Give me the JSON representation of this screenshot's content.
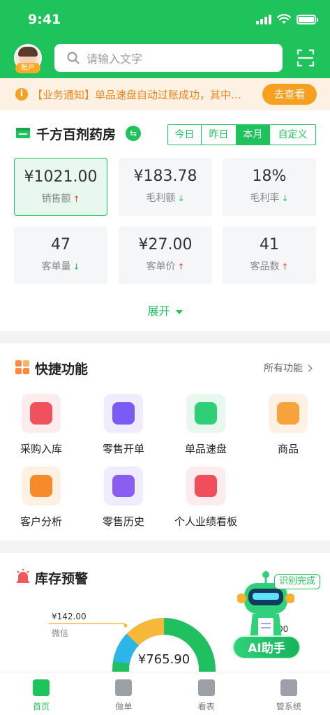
{
  "status_bar": {
    "time": "9:41"
  },
  "header": {
    "account_label": "账户",
    "search_placeholder": "请输入文字"
  },
  "notice": {
    "text": "【业务通知】单品速盘自动过账成功，其中…",
    "button": "去查看"
  },
  "store": {
    "name": "千方百剂药房",
    "periods": [
      "今日",
      "昨日",
      "本月",
      "自定义"
    ],
    "active_period": "本月",
    "metrics": [
      {
        "value": "¥1021.00",
        "label": "销售额",
        "trend": "up",
        "active": true
      },
      {
        "value": "¥183.78",
        "label": "毛利额",
        "trend": "down"
      },
      {
        "value": "18%",
        "label": "毛利率",
        "trend": "down"
      },
      {
        "value": "47",
        "label": "客单量",
        "trend": "down"
      },
      {
        "value": "¥27.00",
        "label": "客单价",
        "trend": "up"
      },
      {
        "value": "41",
        "label": "客品数",
        "trend": "up"
      }
    ],
    "expand_label": "展开"
  },
  "quick": {
    "title": "快捷功能",
    "more_label": "所有功能",
    "items": [
      {
        "label": "采购入库",
        "icon": "shopping-basket-icon",
        "color": "#f0515e",
        "bg": "#fdecee"
      },
      {
        "label": "零售开单",
        "icon": "checklist-icon",
        "color": "#7a5cf5",
        "bg": "#efedfd"
      },
      {
        "label": "单品速盘",
        "icon": "box-search-icon",
        "color": "#2fcf77",
        "bg": "#e8f8ee"
      },
      {
        "label": "商品",
        "icon": "bag-icon",
        "color": "#f7a23a",
        "bg": "#fdf1e4"
      },
      {
        "label": "客户分析",
        "icon": "customer-icon",
        "color": "#f78a2a",
        "bg": "#fdf1e4"
      },
      {
        "label": "零售历史",
        "icon": "history-bag-icon",
        "color": "#8a5cf0",
        "bg": "#efedfd"
      },
      {
        "label": "个人业绩看板",
        "icon": "calendar-chart-icon",
        "color": "#f04e5a",
        "bg": "#fdecee"
      }
    ]
  },
  "inventory": {
    "title": "库存预警",
    "legend_amount": "¥142.00",
    "legend_channel": "微信",
    "center_value": "¥765.90",
    "right_value": "00",
    "colors": {
      "main": "#20c060",
      "second": "#f7b739",
      "third": "#2cb5e8"
    }
  },
  "ai": {
    "badge": "识别完成",
    "button": "AI助手"
  },
  "tabbar": {
    "tabs": [
      {
        "label": "首页",
        "active": true
      },
      {
        "label": "做单"
      },
      {
        "label": "看表"
      },
      {
        "label": "管系统"
      }
    ]
  }
}
